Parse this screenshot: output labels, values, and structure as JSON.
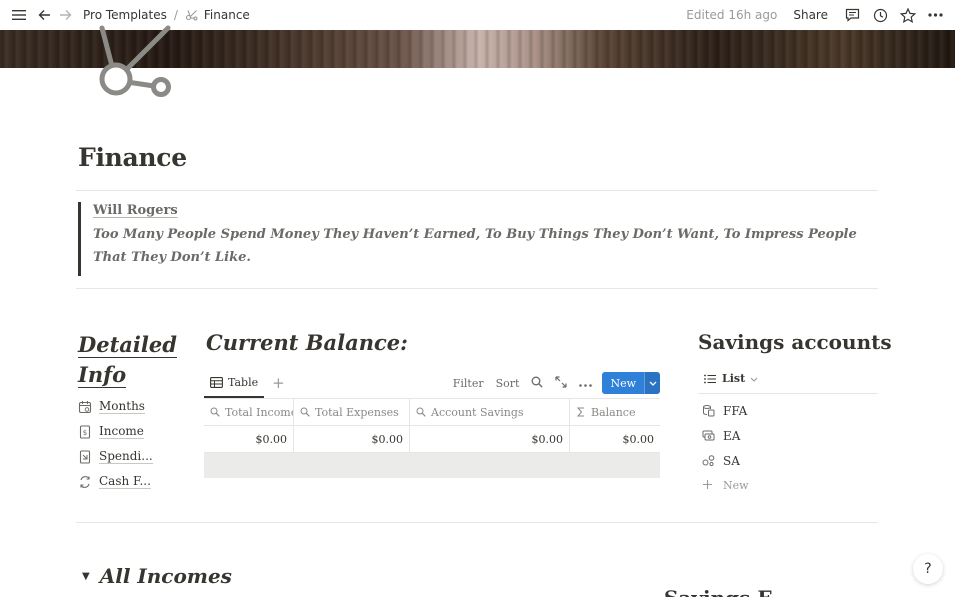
{
  "topbar": {
    "breadcrumbs": [
      {
        "label": "Pro Templates"
      },
      {
        "label": "Finance"
      }
    ],
    "separator": "/",
    "edited": "Edited 16h ago",
    "share_label": "Share"
  },
  "page": {
    "title": "Finance",
    "icon": "network-nodes-icon"
  },
  "quote": {
    "author": "Will Rogers",
    "text": "Too Many People Spend Money They Haven’t Earned, To Buy Things They Don’t Want, To Impress People That They Don’t Like."
  },
  "detailed_info": {
    "title_line1": "Detailed",
    "title_line2": "Info",
    "links": [
      {
        "label": "Months",
        "icon": "calendar-icon"
      },
      {
        "label": "Income",
        "icon": "dollar-doc-icon"
      },
      {
        "label": "Spendi...",
        "icon": "receipt-icon"
      },
      {
        "label": "Cash F...",
        "icon": "cycle-arrows-icon"
      }
    ]
  },
  "current_balance": {
    "title": "Current Balance:",
    "view_tab": "Table",
    "add_view": "+",
    "actions": {
      "filter": "Filter",
      "sort": "Sort",
      "new": "New"
    },
    "columns": [
      "Total Income",
      "Total Expenses",
      "Account Savings",
      "Balance"
    ],
    "rows": [
      [
        "$0.00",
        "$0.00",
        "$0.00",
        "$0.00"
      ]
    ]
  },
  "savings": {
    "title": "Savings accounts",
    "view": "List",
    "items": [
      {
        "label": "FFA",
        "icon": "coins-icon"
      },
      {
        "label": "EA",
        "icon": "cash-icon"
      },
      {
        "label": "SA",
        "icon": "piggy-icon"
      }
    ],
    "new_label": "New"
  },
  "sections": {
    "all_incomes": "All Incomes",
    "right_partial": "Savings E..."
  },
  "help": "?"
}
